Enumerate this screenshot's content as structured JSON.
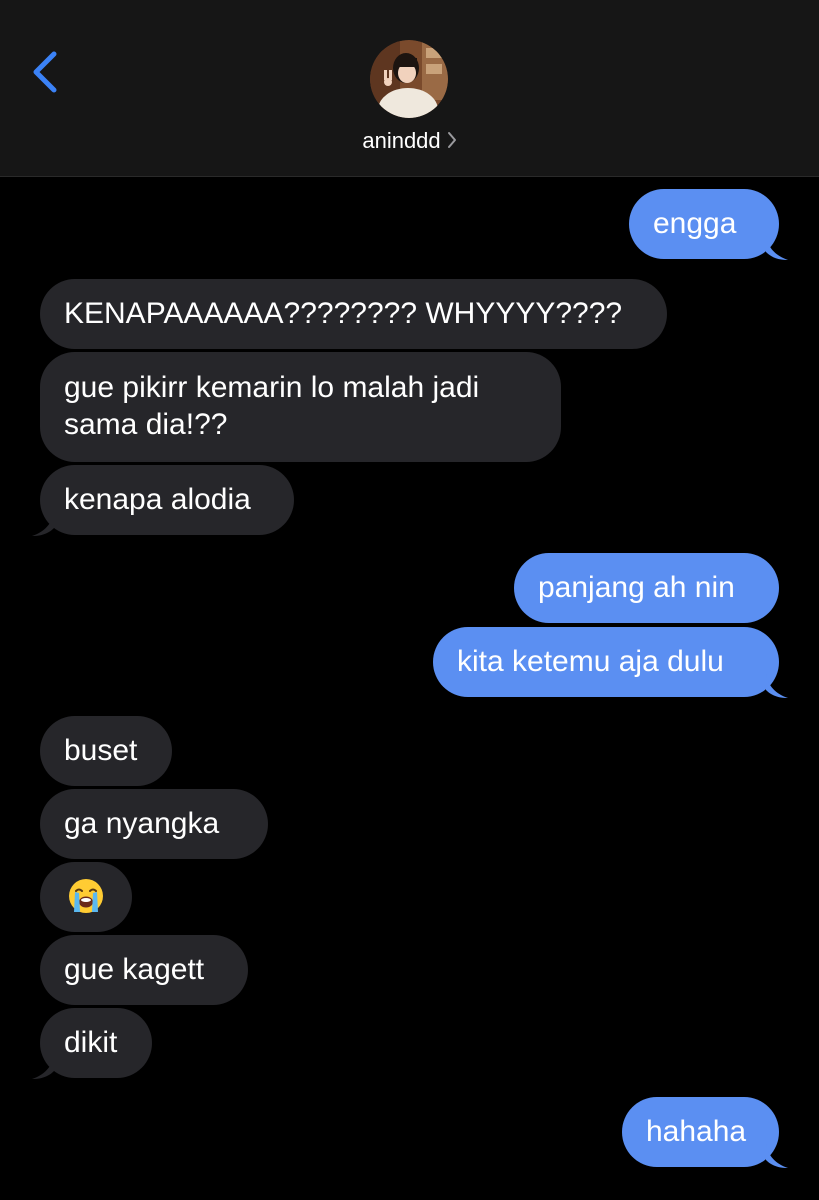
{
  "header": {
    "back_icon": "chevron-left-icon",
    "contact_name": "aninddd",
    "chevron_icon": "chevron-right-icon",
    "accent": "#3b82f6"
  },
  "colors": {
    "outgoing": "#5b8ff2",
    "incoming": "#26262a",
    "background": "#000000",
    "header_bg": "#161616"
  },
  "messages": [
    {
      "direction": "outgoing",
      "text": "engga"
    },
    {
      "direction": "incoming",
      "text": "KENAPAAAAAA???????? WHYYYY????"
    },
    {
      "direction": "incoming",
      "lines": [
        "gue pikirr kemarin lo malah jadi",
        "sama dia!??"
      ]
    },
    {
      "direction": "incoming",
      "text": "kenapa alodia"
    },
    {
      "direction": "outgoing",
      "text": "panjang ah nin"
    },
    {
      "direction": "outgoing",
      "text": "kita ketemu aja dulu"
    },
    {
      "direction": "incoming",
      "text": "buset"
    },
    {
      "direction": "incoming",
      "text": "ga nyangka"
    },
    {
      "direction": "incoming",
      "emoji": "loudly-crying-face-icon"
    },
    {
      "direction": "incoming",
      "text": "gue kagett"
    },
    {
      "direction": "incoming",
      "text": "dikit"
    },
    {
      "direction": "outgoing",
      "text": "hahaha"
    }
  ]
}
